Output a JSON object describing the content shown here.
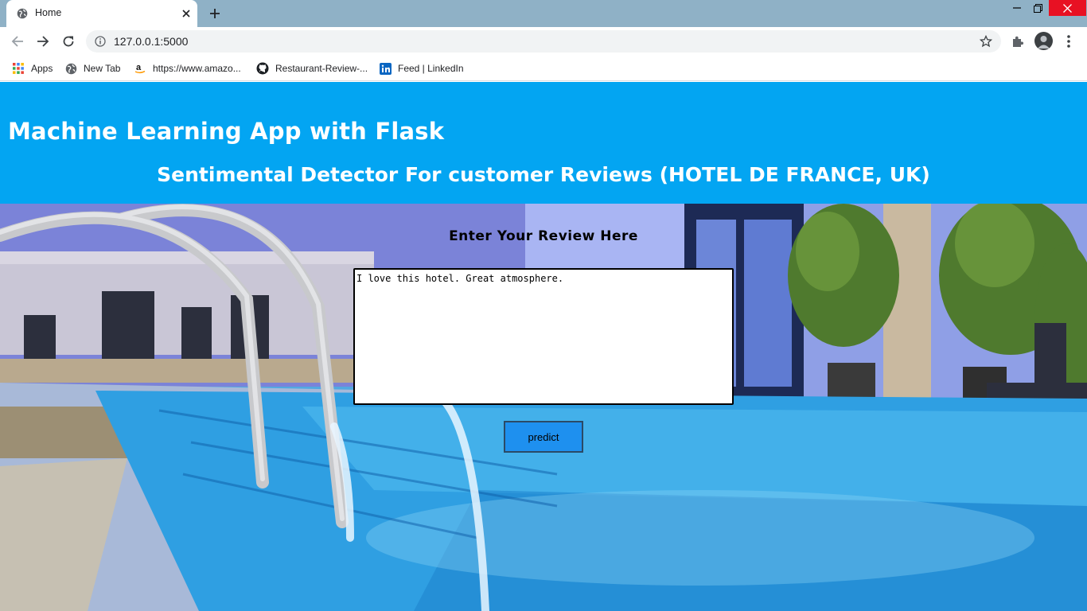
{
  "browser": {
    "tab_title": "Home",
    "url": "127.0.0.1:5000",
    "bookmarks": [
      {
        "label": "Apps",
        "icon": "apps-grid-icon"
      },
      {
        "label": "New Tab",
        "icon": "globe-icon"
      },
      {
        "label": "https://www.amazo...",
        "icon": "amazon-icon"
      },
      {
        "label": "Restaurant-Review-...",
        "icon": "github-icon"
      },
      {
        "label": "Feed | LinkedIn",
        "icon": "linkedin-icon"
      }
    ]
  },
  "header": {
    "title": "Machine Learning App with Flask",
    "subtitle": "Sentimental Detector For customer Reviews (HOTEL DE FRANCE, UK)",
    "background_color": "#03a5f2"
  },
  "form": {
    "heading": "Enter Your Review Here",
    "review_value": "I love this hotel. Great atmosphere.",
    "button_label": "predict",
    "button_color": "#1e90ef"
  }
}
